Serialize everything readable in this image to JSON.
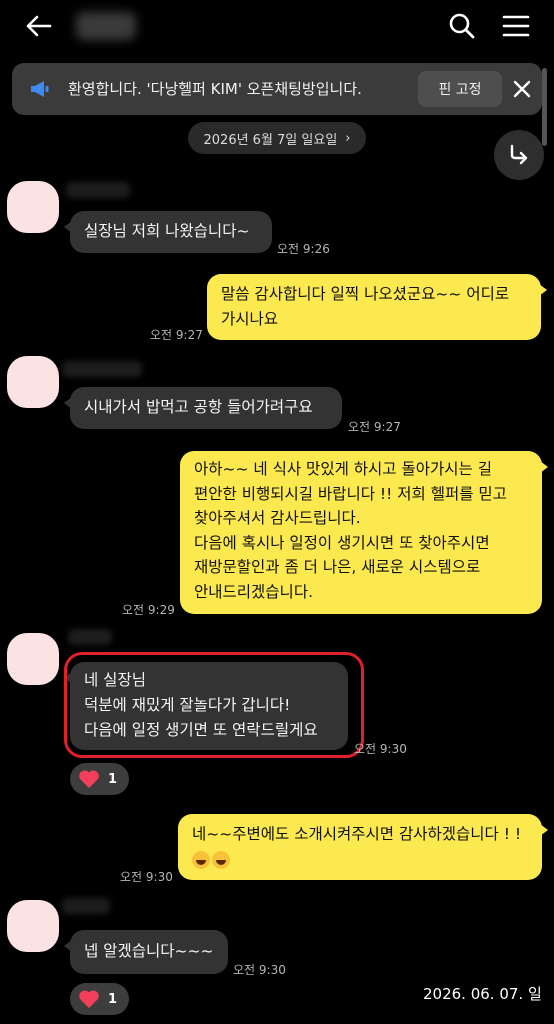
{
  "header": {
    "back_icon": "arrow-left-icon",
    "search_icon": "search-icon",
    "menu_icon": "hamburger-menu-icon"
  },
  "notice": {
    "icon": "megaphone-icon",
    "icon_color": "#3d8bf2",
    "text": "환영합니다. '다낭헬퍼 KIM' 오픈채팅방입니다.",
    "pin_label": "핀 고정",
    "close_icon": "close-icon"
  },
  "date_chip": {
    "label": "2026년 6월 7일 일요일",
    "chevron": "›"
  },
  "scroll_down_icon": "arrow-turn-down-icon",
  "messages": [
    {
      "side": "in",
      "lines": [
        "실장님 저희 나왔습니다~"
      ],
      "time": "오전 9:26"
    },
    {
      "side": "out",
      "lines": [
        "말씀 감사합니다 일찍 나오셨군요~~  어디로",
        "가시나요"
      ],
      "time": "오전 9:27"
    },
    {
      "side": "in",
      "lines": [
        "시내가서 밥먹고 공항 들어가려구요"
      ],
      "time": "오전 9:27"
    },
    {
      "side": "out",
      "lines": [
        "아하~~ 네 식사 맛있게 하시고 돌아가시는 길",
        "편안한 비행되시길 바랍니다 !!  저희 헬퍼를 믿고",
        "찾아주셔서 감사드립니다.",
        "다음에 혹시나 일정이 생기시면 또 찾아주시면",
        "재방문할인과 좀 더 나은,  새로운 시스템으로",
        "안내드리겠습니다."
      ],
      "time": "오전 9:29"
    },
    {
      "side": "in",
      "lines": [
        "네 실장님",
        "덕분에 재밌게 잘놀다가 갑니다!",
        "다음에 일정 생기면 또 연락드릴게요"
      ],
      "time": "오전 9:30",
      "reaction": {
        "icon": "heart-icon",
        "count": "1"
      }
    },
    {
      "side": "out",
      "lines": [
        "네~~주변에도 소개시켜주시면 감사하겠습니다 ! !"
      ],
      "emoji": "grinning-face-emoji x2",
      "time": "오전 9:30"
    },
    {
      "side": "in",
      "lines": [
        "넵 알겠습니다~~~"
      ],
      "time": "오전 9:30",
      "reaction": {
        "icon": "heart-icon",
        "count": "1"
      }
    }
  ],
  "colors": {
    "background": "#000000",
    "incoming_bubble": "#333333",
    "outgoing_bubble": "#fce94f",
    "highlight_outline": "#e0202a",
    "heart": "#f2405c"
  },
  "watermark": "2026. 06. 07. 일"
}
